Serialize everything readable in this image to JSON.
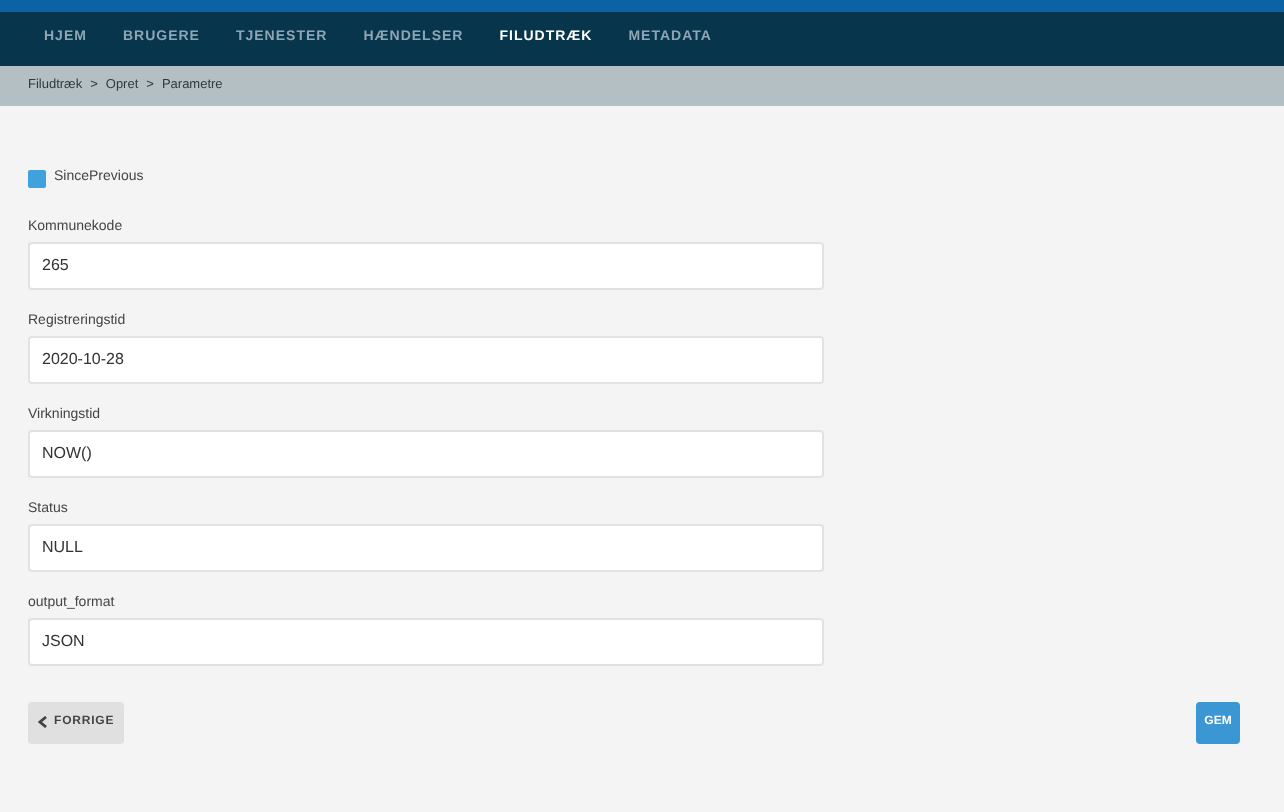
{
  "nav": {
    "items": [
      {
        "label": "HJEM",
        "selected": false
      },
      {
        "label": "BRUGERE",
        "selected": false
      },
      {
        "label": "TJENESTER",
        "selected": false
      },
      {
        "label": "HÆNDELSER",
        "selected": false
      },
      {
        "label": "FILUDTRÆK",
        "selected": true
      },
      {
        "label": "METADATA",
        "selected": false
      }
    ]
  },
  "breadcrumb": [
    "Filudtræk",
    "Opret",
    "Parametre"
  ],
  "breadcrumb_separator": ">",
  "checkbox": {
    "label": "SincePrevious",
    "checked": true
  },
  "fields": [
    {
      "label": "Kommunekode",
      "value": "265"
    },
    {
      "label": "Registreringstid",
      "value": "2020-10-28"
    },
    {
      "label": "Virkningstid",
      "value": "NOW()"
    },
    {
      "label": "Status",
      "value": "NULL"
    },
    {
      "label": "output_format",
      "value": "JSON"
    }
  ],
  "buttons": {
    "back": "FORRIGE",
    "save": "GEM"
  }
}
